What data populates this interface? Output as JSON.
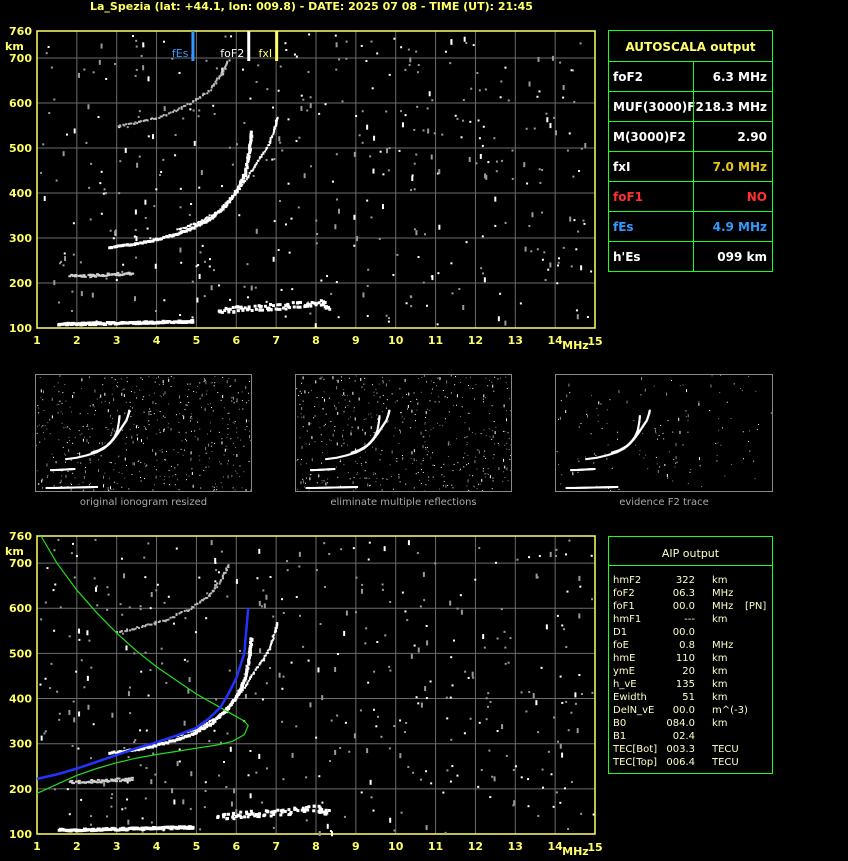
{
  "header": {
    "title": "La_Spezia (lat: +44.1, lon: 009.8) - DATE: 2025 07 08 - TIME (UT): 21:45"
  },
  "chart_data": [
    {
      "type": "scatter",
      "xunit": "MHz",
      "yunit": "km",
      "xticks": [
        "1",
        "2",
        "3",
        "4",
        "5",
        "6",
        "7",
        "8",
        "9",
        "10",
        "11",
        "12",
        "13",
        "14",
        "15"
      ],
      "yticks": [
        "100",
        "200",
        "300",
        "400",
        "500",
        "600",
        "700",
        "760"
      ],
      "xlim": [
        1,
        15
      ],
      "ylim": [
        100,
        760
      ],
      "grid": true,
      "markers": [
        {
          "label": "fEs",
          "x": 4.9,
          "color": "#3399ff"
        },
        {
          "label": "foF2",
          "x": 6.3,
          "color": "#ffffff"
        },
        {
          "label": "fxI",
          "x": 7.0,
          "color": "#ffff66"
        }
      ],
      "traces": {
        "es_layer": [
          [
            1.5,
            112
          ],
          [
            2,
            112
          ],
          [
            2.5,
            113
          ],
          [
            3,
            114
          ],
          [
            3.5,
            115
          ],
          [
            4,
            116
          ],
          [
            4.5,
            117
          ],
          [
            4.9,
            118
          ]
        ],
        "e_region": [
          [
            1.8,
            217
          ],
          [
            2.2,
            218
          ],
          [
            2.6,
            220
          ],
          [
            3,
            222
          ],
          [
            3.4,
            224
          ]
        ],
        "o_trace": [
          [
            2.8,
            282
          ],
          [
            3.5,
            290
          ],
          [
            4.2,
            305
          ],
          [
            4.8,
            322
          ],
          [
            5.3,
            345
          ],
          [
            5.7,
            375
          ],
          [
            6.0,
            410
          ],
          [
            6.2,
            450
          ],
          [
            6.3,
            500
          ],
          [
            6.35,
            540
          ]
        ],
        "x_trace": [
          [
            4.5,
            320
          ],
          [
            5.0,
            335
          ],
          [
            5.5,
            360
          ],
          [
            5.9,
            395
          ],
          [
            6.2,
            430
          ],
          [
            6.5,
            470
          ],
          [
            6.8,
            510
          ],
          [
            6.95,
            550
          ],
          [
            7.0,
            570
          ]
        ],
        "f2_echo": [
          [
            3.0,
            550
          ],
          [
            3.6,
            560
          ],
          [
            4.2,
            575
          ],
          [
            4.8,
            600
          ],
          [
            5.3,
            630
          ],
          [
            5.6,
            665
          ],
          [
            5.8,
            700
          ]
        ],
        "high_noise": [
          [
            5.5,
            140
          ],
          [
            6.0,
            145
          ],
          [
            6.5,
            148
          ],
          [
            7.0,
            150
          ],
          [
            7.5,
            155
          ],
          [
            8.0,
            160
          ],
          [
            8.3,
            150
          ]
        ]
      }
    },
    {
      "type": "scatter",
      "xunit": "MHz",
      "yunit": "km",
      "xticks": [
        "1",
        "2",
        "3",
        "4",
        "5",
        "6",
        "7",
        "8",
        "9",
        "10",
        "11",
        "12",
        "13",
        "14",
        "15"
      ],
      "yticks": [
        "100",
        "200",
        "300",
        "400",
        "500",
        "600",
        "700",
        "760"
      ],
      "xlim": [
        1,
        15
      ],
      "ylim": [
        100,
        760
      ],
      "grid": true,
      "profile_green": [
        [
          1.1,
          760
        ],
        [
          1.5,
          700
        ],
        [
          2.0,
          640
        ],
        [
          2.5,
          590
        ],
        [
          3.0,
          545
        ],
        [
          3.5,
          505
        ],
        [
          4.0,
          470
        ],
        [
          4.5,
          440
        ],
        [
          5.0,
          410
        ],
        [
          5.5,
          385
        ],
        [
          5.9,
          365
        ],
        [
          6.2,
          350
        ],
        [
          6.3,
          340
        ],
        [
          6.2,
          320
        ],
        [
          5.9,
          305
        ],
        [
          5.5,
          297
        ],
        [
          5.0,
          290
        ],
        [
          4.5,
          283
        ],
        [
          4.0,
          276
        ],
        [
          3.5,
          268
        ],
        [
          3.0,
          258
        ],
        [
          2.5,
          245
        ],
        [
          2.0,
          230
        ],
        [
          1.5,
          210
        ],
        [
          1.0,
          190
        ]
      ],
      "profile_blue": [
        [
          1,
          222
        ],
        [
          1.5,
          232
        ],
        [
          2,
          245
        ],
        [
          2.5,
          260
        ],
        [
          3,
          275
        ],
        [
          3.5,
          290
        ],
        [
          4,
          303
        ],
        [
          4.5,
          318
        ],
        [
          5,
          335
        ],
        [
          5.3,
          355
        ],
        [
          5.6,
          380
        ],
        [
          5.8,
          410
        ],
        [
          6.0,
          445
        ],
        [
          6.2,
          500
        ],
        [
          6.3,
          600
        ]
      ]
    }
  ],
  "autoscala": {
    "title": "AUTOSCALA output",
    "rows": [
      {
        "label": "foF2",
        "value": "6.3 MHz",
        "label_color": "#ffffff",
        "value_color": "#ffffff"
      },
      {
        "label": "MUF(3000)F2",
        "value": "18.3 MHz",
        "label_color": "#ffffff",
        "value_color": "#ffffff"
      },
      {
        "label": "M(3000)F2",
        "value": "2.90",
        "label_color": "#ffffff",
        "value_color": "#ffffff"
      },
      {
        "label": "fxI",
        "value": "7.0 MHz",
        "label_color": "#ffffff",
        "value_color": "#e6c619"
      },
      {
        "label": "foF1",
        "value": "NO",
        "label_color": "#ff3030",
        "value_color": "#ff3030"
      },
      {
        "label": "fEs",
        "value": "4.9 MHz",
        "label_color": "#3399ff",
        "value_color": "#3399ff"
      },
      {
        "label": "h'Es",
        "value": "099     km",
        "label_color": "#ffffff",
        "value_color": "#ffffff"
      }
    ]
  },
  "thumbnails": [
    {
      "caption": "original ionogram resized"
    },
    {
      "caption": "eliminate multiple reflections"
    },
    {
      "caption": "evidence F2 trace"
    }
  ],
  "aip": {
    "title": "AIP output",
    "rows": [
      [
        "hmF2",
        "322",
        "km",
        ""
      ],
      [
        "foF2",
        "06.3",
        "MHz",
        ""
      ],
      [
        "foF1",
        "00.0",
        "MHz",
        "[PN]"
      ],
      [
        "hmF1",
        "---",
        "km",
        ""
      ],
      [
        "D1",
        "00.0",
        "",
        ""
      ],
      [
        "foE",
        "0.8",
        "MHz",
        ""
      ],
      [
        "hmE",
        "110",
        "km",
        ""
      ],
      [
        "ymE",
        "20",
        "km",
        ""
      ],
      [
        "h_vE",
        "135",
        "km",
        ""
      ],
      [
        "Ewidth",
        "51",
        "km",
        ""
      ],
      [
        "DelN_vE",
        "00.0",
        "m^(-3)",
        ""
      ],
      [
        "B0",
        "084.0",
        "km",
        ""
      ],
      [
        "B1",
        "02.4",
        "",
        ""
      ],
      [
        "TEC[Bot]",
        "003.3",
        "TECU",
        ""
      ],
      [
        "TEC[Top]",
        "006.4",
        "TECU",
        ""
      ]
    ]
  }
}
